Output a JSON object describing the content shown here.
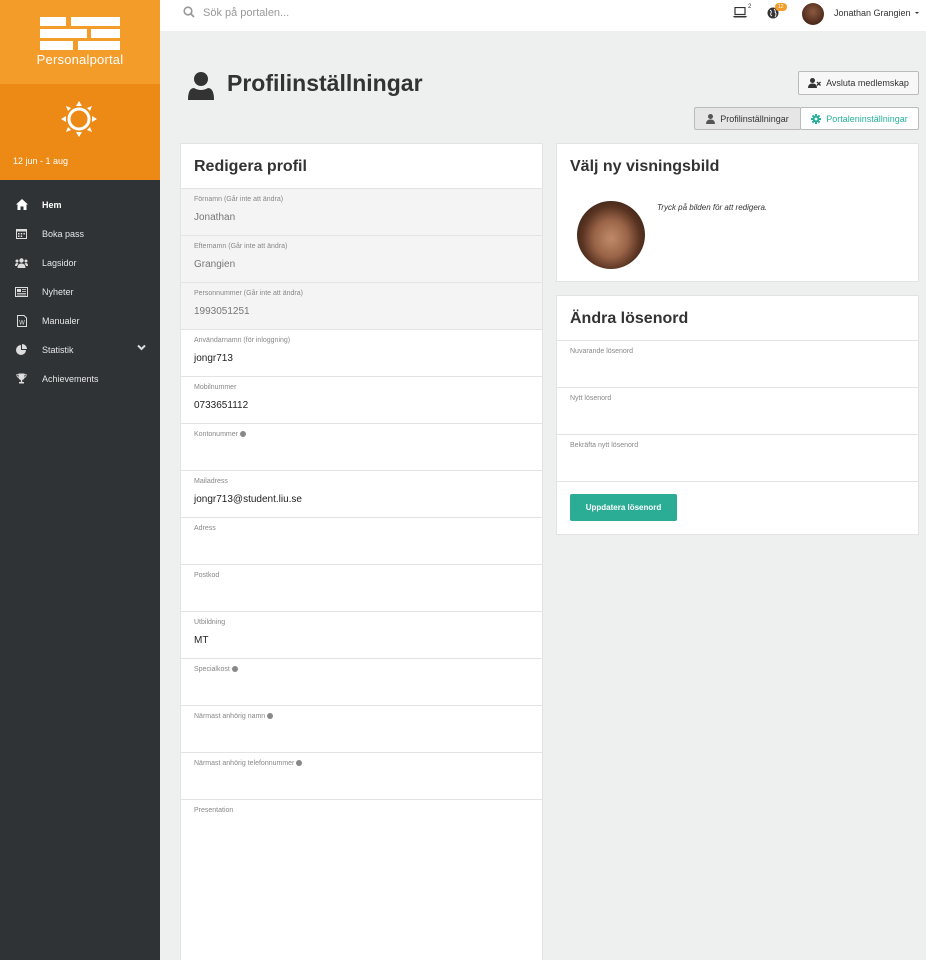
{
  "app": {
    "logo_text": "Personalportal",
    "season": "12 jun - 1 aug",
    "brand_color": "#f49c2a",
    "accent_color": "#2bad95"
  },
  "sidebar": {
    "items": [
      {
        "label": "Hem",
        "icon": "home-icon",
        "active": true
      },
      {
        "label": "Boka pass",
        "icon": "calendar-icon"
      },
      {
        "label": "Lagsidor",
        "icon": "users-icon"
      },
      {
        "label": "Nyheter",
        "icon": "newspaper-icon"
      },
      {
        "label": "Manualer",
        "icon": "document-icon"
      },
      {
        "label": "Statistik",
        "icon": "pie-chart-icon",
        "has_submenu": true
      },
      {
        "label": "Achievements",
        "icon": "trophy-icon"
      }
    ]
  },
  "topbar": {
    "search_placeholder": "Sök på portalen...",
    "laptop_count": "2",
    "globe_badge": "12",
    "user_name": "Jonathan Grangien"
  },
  "page": {
    "title": "Profilinställningar",
    "leave_button": "Avsluta medlemskap",
    "tab_profile": "Profilinställningar",
    "tab_portal": "Portaleninställningar"
  },
  "edit_profile": {
    "title": "Redigera profil",
    "fields": [
      {
        "label": "Förnamn (Går inte att ändra)",
        "value": "Jonathan",
        "disabled": true
      },
      {
        "label": "Efternamn (Går inte att ändra)",
        "value": "Grangien",
        "disabled": true
      },
      {
        "label": "Personnummer (Går inte att ändra)",
        "value": "1993051251",
        "disabled": true
      },
      {
        "label": "Användarnamn (för inloggning)",
        "value": "jongr713"
      },
      {
        "label": "Mobilnummer",
        "value": "0733651112"
      },
      {
        "label": "Kontonummer",
        "value": "",
        "info": true
      },
      {
        "label": "Mailadress",
        "value": "jongr713@student.liu.se"
      },
      {
        "label": "Adress",
        "value": ""
      },
      {
        "label": "Postkod",
        "value": ""
      },
      {
        "label": "Utbildning",
        "value": "MT"
      },
      {
        "label": "Specialkost",
        "value": "",
        "info": true
      },
      {
        "label": "Närmast anhörig namn",
        "value": "",
        "info": true
      },
      {
        "label": "Närmast anhörig telefonnummer",
        "value": "",
        "info": true
      },
      {
        "label": "Presentation",
        "value": ""
      }
    ]
  },
  "photo": {
    "title": "Välj ny visningsbild",
    "hint": "Tryck på bilden för att redigera."
  },
  "password": {
    "title": "Ändra lösenord",
    "fields": [
      {
        "label": "Nuvarande lösenord"
      },
      {
        "label": "Nytt lösenord"
      },
      {
        "label": "Bekräfta nytt lösenord"
      }
    ],
    "submit": "Uppdatera lösenord"
  }
}
